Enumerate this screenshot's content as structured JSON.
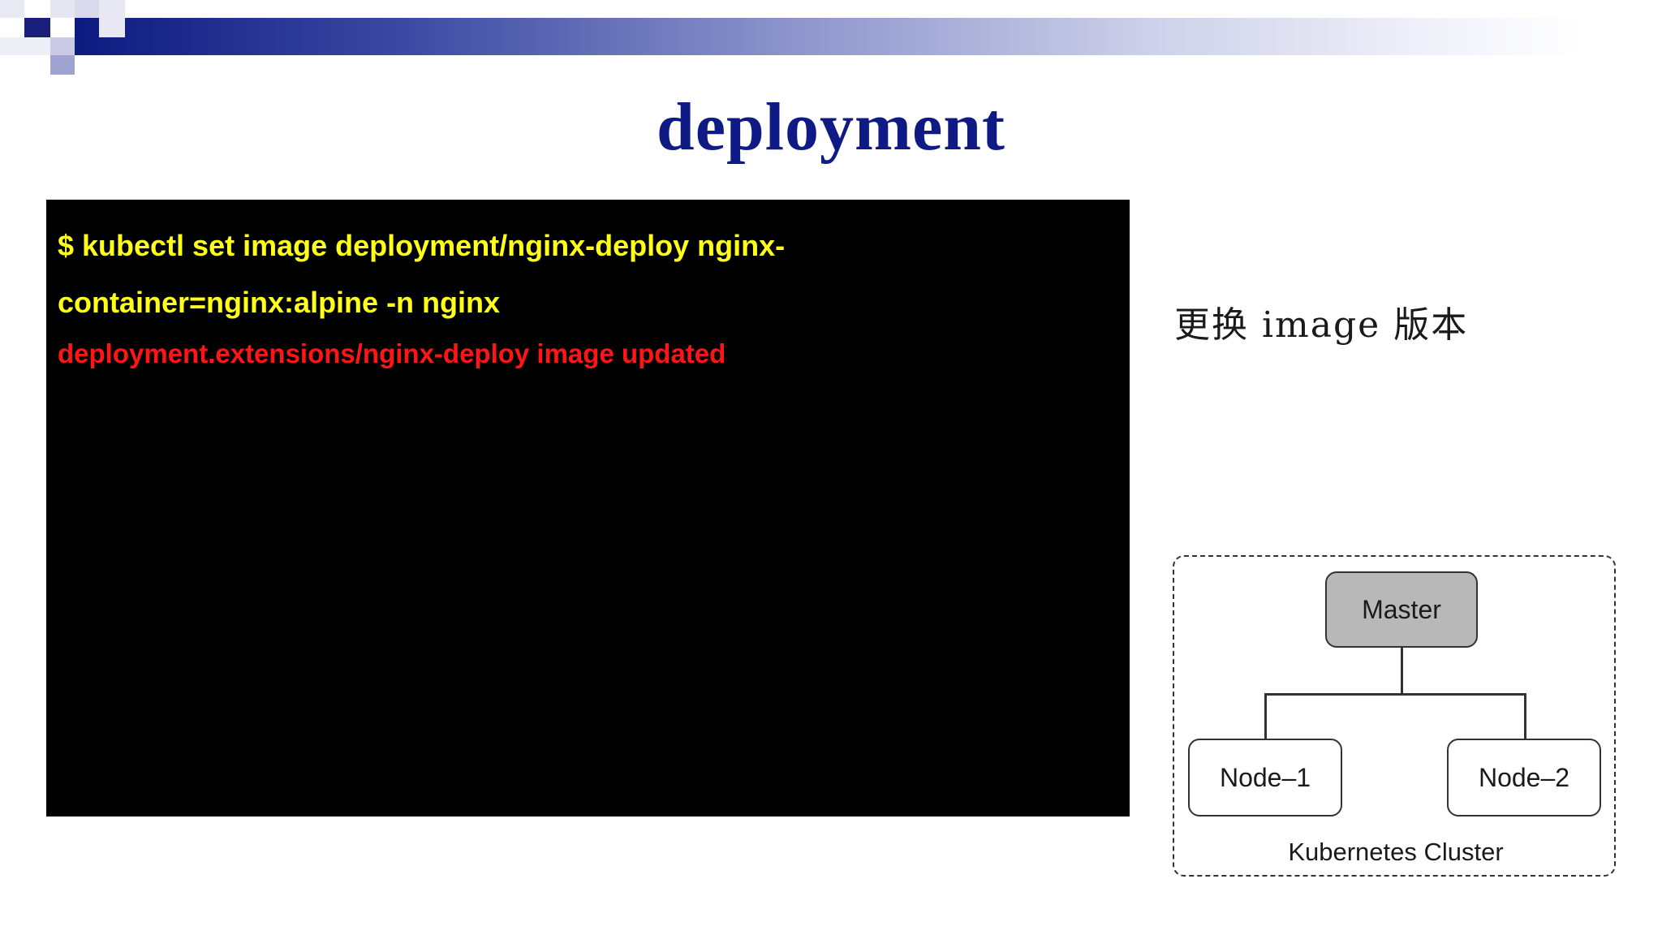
{
  "slide": {
    "title": "deployment",
    "terminal": {
      "command_line_1": "$ kubectl set image deployment/nginx-deploy nginx-",
      "command_line_2": "container=nginx:alpine -n nginx",
      "output": "deployment.extensions/nginx-deploy image updated"
    },
    "side_note": "更换 image 版本",
    "diagram": {
      "master_label": "Master",
      "node1_label": "Node–1",
      "node2_label": "Node–2",
      "cluster_label": "Kubernetes Cluster"
    },
    "colors": {
      "title": "#0f1a85",
      "terminal_bg": "#000000",
      "command_text": "#ffff1a",
      "output_text": "#ff1515",
      "master_fill": "#b8b8b8"
    }
  }
}
